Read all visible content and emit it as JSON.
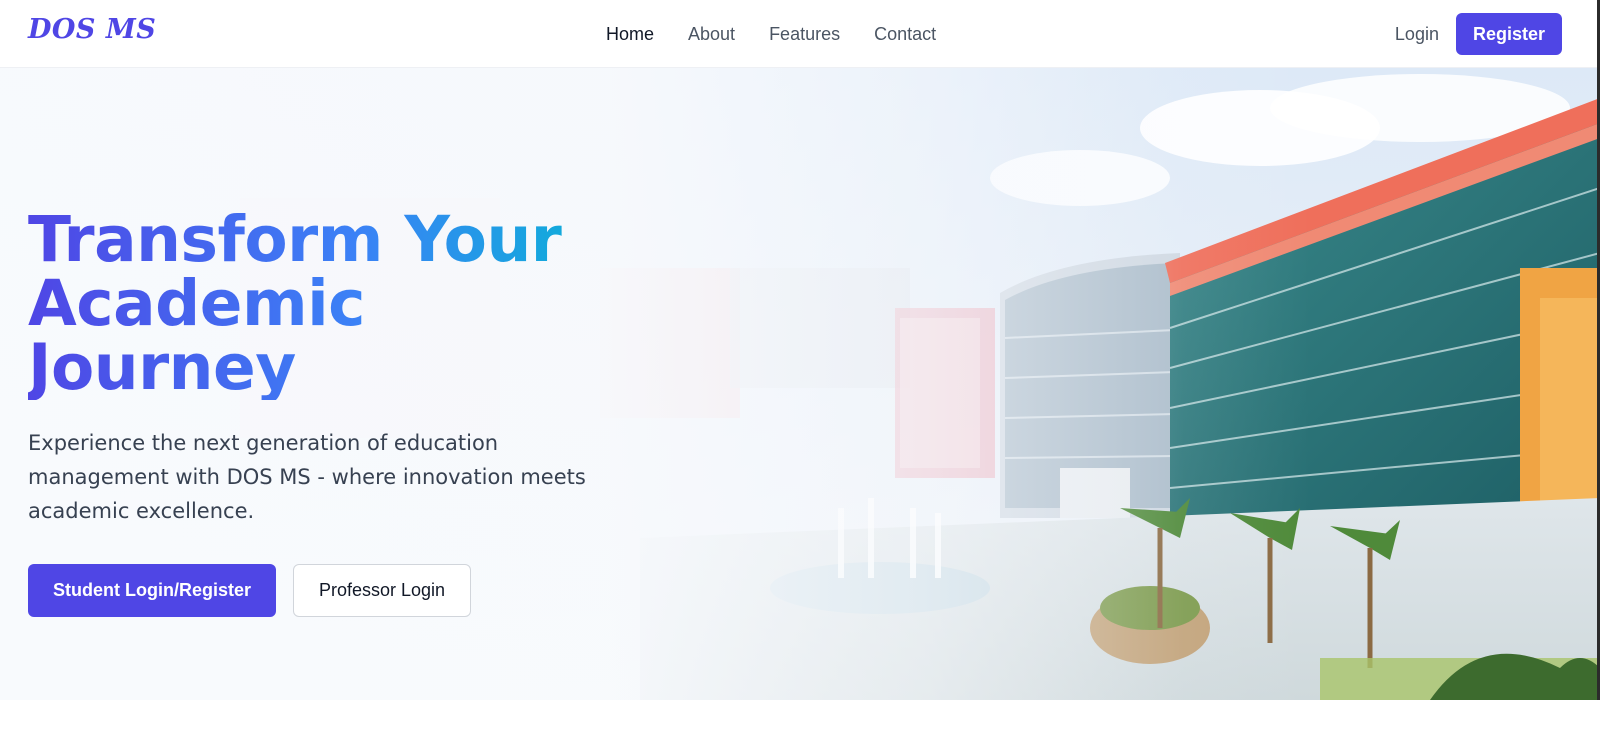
{
  "brand": {
    "name": "DOS MS",
    "color": "#4f46e5"
  },
  "nav": {
    "links": [
      {
        "label": "Home",
        "active": true
      },
      {
        "label": "About",
        "active": false
      },
      {
        "label": "Features",
        "active": false
      },
      {
        "label": "Contact",
        "active": false
      }
    ]
  },
  "auth": {
    "login_label": "Login",
    "register_label": "Register"
  },
  "hero": {
    "title_line1": "Transform Your",
    "title_line2": "Academic Journey",
    "subtitle": "Experience the next generation of education management with DOS MS - where innovation meets academic excellence.",
    "primary_cta": "Student Login/Register",
    "secondary_cta": "Professor Login",
    "background_image": "campus-illustration",
    "gradient_colors": [
      "#4f46e5",
      "#3b82f6",
      "#06b6d4"
    ]
  }
}
